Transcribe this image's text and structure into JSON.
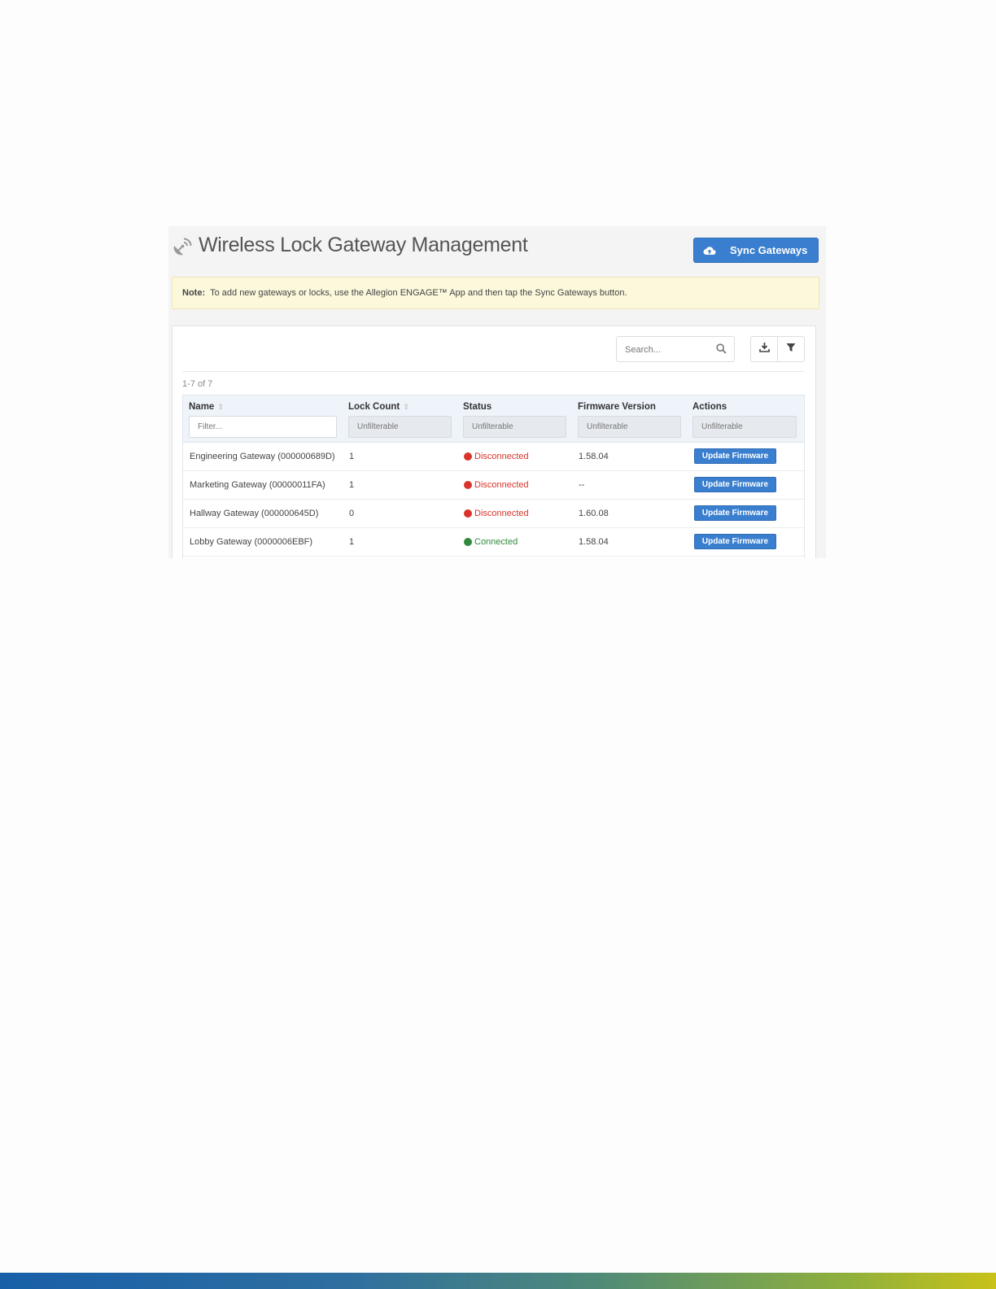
{
  "page": {
    "title": "Wireless Lock Gateway Management",
    "title_icon": "satellite-dish-icon",
    "sync_button": {
      "label": "Sync Gateways",
      "icon": "cloud-upload-icon"
    }
  },
  "note": {
    "label": "Note:",
    "text": "To add new gateways or locks, use the Allegion ENGAGE™ App and then tap the Sync Gateways button."
  },
  "toolbar": {
    "search_placeholder": "Search...",
    "search_icon": "search-icon",
    "download_icon": "download-icon",
    "filter_icon": "filter-icon"
  },
  "table": {
    "count_text": "1-7 of 7",
    "columns": [
      {
        "label": "Name",
        "sortable": true,
        "filter_placeholder": "Filter...",
        "filter_enabled": true
      },
      {
        "label": "Lock Count",
        "sortable": true,
        "filter_placeholder": "Unfilterable",
        "filter_enabled": false
      },
      {
        "label": "Status",
        "sortable": false,
        "filter_placeholder": "Unfilterable",
        "filter_enabled": false
      },
      {
        "label": "Firmware Version",
        "sortable": false,
        "filter_placeholder": "Unfilterable",
        "filter_enabled": false
      },
      {
        "label": "Actions",
        "sortable": false,
        "filter_placeholder": "Unfilterable",
        "filter_enabled": false
      }
    ],
    "rows": [
      {
        "name": "Engineering Gateway (000000689D)",
        "lock_count": "1",
        "status": "Disconnected",
        "firmware": "1.58.04",
        "action": "Update Firmware"
      },
      {
        "name": "Marketing Gateway (00000011FA)",
        "lock_count": "1",
        "status": "Disconnected",
        "firmware": "--",
        "action": "Update Firmware"
      },
      {
        "name": "Hallway Gateway (000000645D)",
        "lock_count": "0",
        "status": "Disconnected",
        "firmware": "1.60.08",
        "action": "Update Firmware"
      },
      {
        "name": "Lobby Gateway (0000006EBF)",
        "lock_count": "1",
        "status": "Connected",
        "firmware": "1.58.04",
        "action": "Update Firmware"
      }
    ]
  },
  "colors": {
    "primary": "#3a7fcf",
    "disconnected": "#d9342b",
    "connected": "#2f8a3c",
    "note_bg": "#fcf8dc"
  }
}
